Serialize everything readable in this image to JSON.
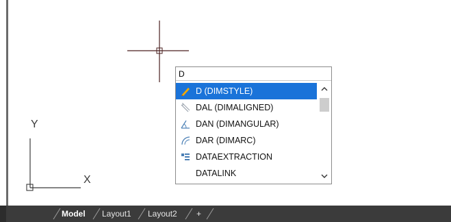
{
  "command_line": {
    "input_value": "D",
    "suggestions": [
      {
        "label": "D (DIMSTYLE)",
        "icon": "dimstyle-icon",
        "selected": true
      },
      {
        "label": "DAL (DIMALIGNED)",
        "icon": "dimaligned-icon",
        "selected": false
      },
      {
        "label": "DAN (DIMANGULAR)",
        "icon": "dimangular-icon",
        "selected": false
      },
      {
        "label": "DAR (DIMARC)",
        "icon": "dimarc-icon",
        "selected": false
      },
      {
        "label": "DATAEXTRACTION",
        "icon": "dataextraction-icon",
        "selected": false
      },
      {
        "label": "DATALINK",
        "icon": "",
        "selected": false
      }
    ],
    "colors": {
      "selection": "#1a73d9"
    }
  },
  "ucs": {
    "y_label": "Y",
    "x_label": "X"
  },
  "layout_tabs": {
    "tabs": [
      {
        "label": "Model",
        "active": true
      },
      {
        "label": "Layout1",
        "active": false
      },
      {
        "label": "Layout2",
        "active": false
      }
    ],
    "add_label": "+"
  },
  "colors": {
    "crosshair": "#4a1f1f",
    "tab_bar": "#3b3b3b"
  }
}
